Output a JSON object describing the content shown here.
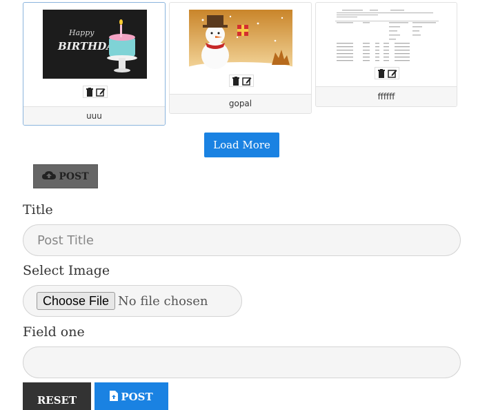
{
  "gallery": {
    "cards": [
      {
        "caption": "uuu",
        "image": "birthday-cake-image"
      },
      {
        "caption": "gopal",
        "image": "snowman-christmas-image"
      },
      {
        "caption": "ffffff",
        "image": "document-screenshot-image"
      }
    ],
    "thumbnail_text": {
      "happy": "Happy",
      "birthday": "BIRTHDAY"
    },
    "load_more_label": "Load More"
  },
  "post_toggle": {
    "label": "POST",
    "icon": "cloud-upload-icon"
  },
  "form": {
    "title_label": "Title",
    "title_placeholder": "Post Title",
    "image_label": "Select Image",
    "file_button": "Choose File",
    "file_status": "No file chosen",
    "field_one_label": "Field one",
    "field_one_value": ""
  },
  "buttons": {
    "reset": "RESET",
    "post": "POST",
    "post_icon": "file-upload-icon"
  },
  "colors": {
    "primary": "#1a82e2",
    "dark": "#333333",
    "toggle": "#666666"
  }
}
